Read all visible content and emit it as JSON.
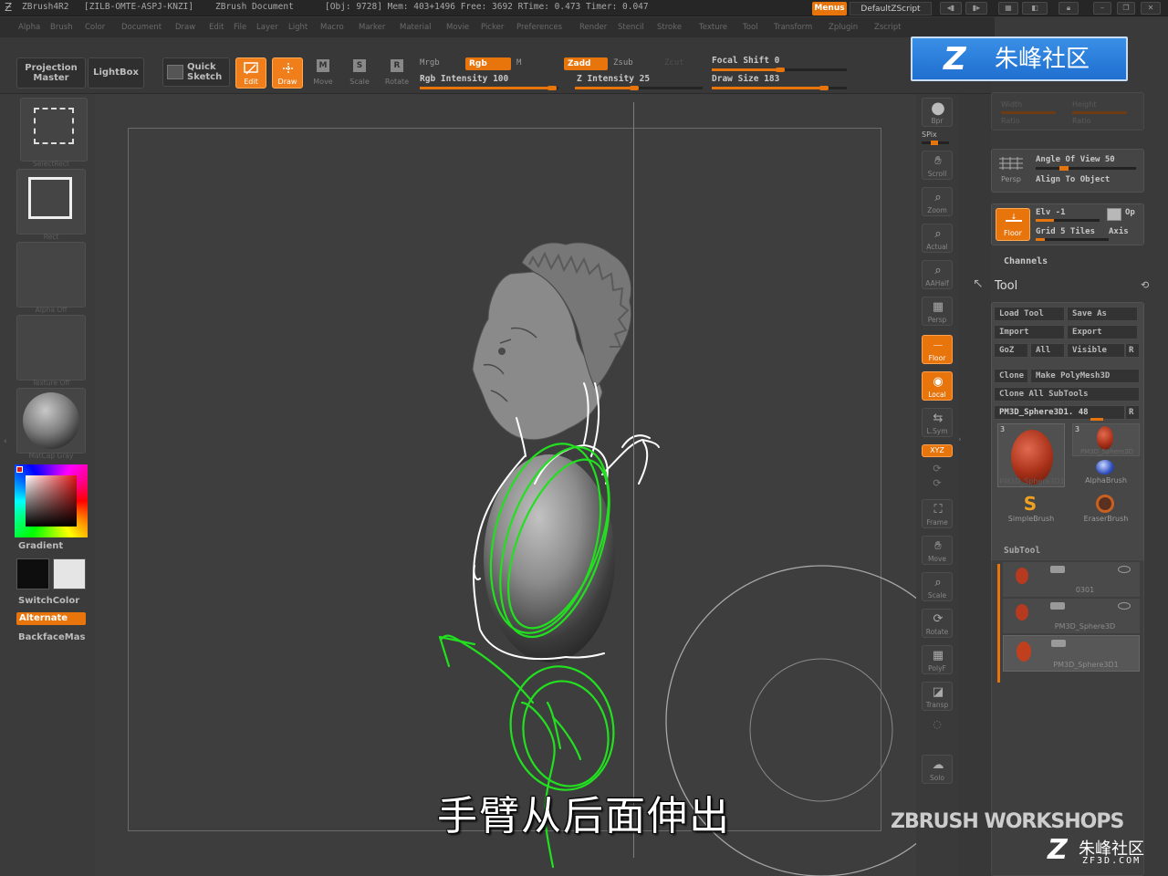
{
  "titlebar": {
    "app": "ZBrush4R2",
    "serial": "[ZILB-OMTE-ASPJ-KNZI]",
    "document": "ZBrush Document",
    "stats": "[Obj: 9728] Mem: 403+1496 Free: 3692 RTime: 0.473 Timer: 0.047",
    "menus_label": "Menus",
    "script_label": "DefaultZScript"
  },
  "menubar": [
    "Alpha",
    "Brush",
    "Color",
    "Document",
    "Draw",
    "Edit",
    "File",
    "Layer",
    "Light",
    "Macro",
    "Marker",
    "Material",
    "Movie",
    "Picker",
    "Preferences",
    "Render",
    "Stencil",
    "Stroke",
    "Texture",
    "Tool",
    "Transform",
    "Zplugin",
    "Zscript"
  ],
  "topshelf": {
    "projection_master": "Projection\nMaster",
    "lightbox": "LightBox",
    "quick_sketch": "Quick\nSketch",
    "edit": "Edit",
    "draw": "Draw",
    "move": "Move",
    "scale": "Scale",
    "rotate": "Rotate",
    "mrgb": "Mrgb",
    "rgb": "Rgb",
    "m": "M",
    "rgb_intensity": "Rgb Intensity 100",
    "zadd": "Zadd",
    "zsub": "Zsub",
    "zcut": "Zcut",
    "z_intensity": "Z Intensity 25",
    "focal_shift": "Focal Shift 0",
    "draw_size": "Draw Size 183"
  },
  "leftshelf": {
    "thumb_labels": [
      "SelectRect",
      "Rect",
      "Alpha Off",
      "Texture Off",
      "MatCap Gray"
    ],
    "gradient": "Gradient",
    "switchcolor": "SwitchColor",
    "alternate": "Alternate",
    "backface": "BackfaceMas"
  },
  "rightshelf": [
    {
      "label": "Bpr",
      "icon": "sphere-icon"
    },
    {
      "label": "SPix",
      "icon": "spix-slider"
    },
    {
      "label": "Scroll",
      "icon": "hand-icon"
    },
    {
      "label": "Zoom",
      "icon": "magnifier-icon"
    },
    {
      "label": "Actual",
      "icon": "magnifier-icon"
    },
    {
      "label": "AAHalf",
      "icon": "magnifier-icon"
    },
    {
      "label": "Persp",
      "icon": "grid-icon"
    },
    {
      "label": "Floor",
      "icon": "floor-icon"
    },
    {
      "label": "Local",
      "icon": "local-icon"
    },
    {
      "label": "L.Sym",
      "icon": "arrows-icon"
    },
    {
      "label": "XYZ",
      "icon": "xyz-icon"
    },
    {
      "label": "Frame",
      "icon": "frame-icon"
    },
    {
      "label": "Move",
      "icon": "hand-icon"
    },
    {
      "label": "Scale",
      "icon": "magnifier-icon"
    },
    {
      "label": "Rotate",
      "icon": "rotate-icon"
    },
    {
      "label": "PolyF",
      "icon": "grid-icon"
    },
    {
      "label": "Transp",
      "icon": "transp-icon"
    },
    {
      "label": "Solo",
      "icon": "solo-icon"
    }
  ],
  "brand": {
    "banner_z": "Z",
    "banner_text": "朱峰社区",
    "corner_z": "Z",
    "corner_cn": "朱峰社区",
    "corner_url": "ZF3D.COM",
    "workshops": "ZBRUSH WORKSHOPS"
  },
  "rightpanel": {
    "width_label": "Width",
    "height_label": "Height",
    "ratio_label": "Ratio",
    "persp_label": "Persp",
    "angle_of_view": "Angle Of View 50",
    "align_to_object": "Align To Object",
    "floor_label": "Floor",
    "elv": "Elv -1",
    "op": "Op",
    "grid_tiles": "Grid 5 Tiles",
    "axis": "Axis",
    "channels": "Channels",
    "tool_title": "Tool",
    "load_tool": "Load Tool",
    "save_as": "Save As",
    "import": "Import",
    "export": "Export",
    "goz": "GoZ",
    "all": "All",
    "visible": "Visible",
    "r": "R",
    "clone": "Clone",
    "make_polymesh": "Make PolyMesh3D",
    "clone_all": "Clone All SubTools",
    "current_tool": "PM3D_Sphere3D1. 48",
    "tool_count_a": "3",
    "tool_count_b": "3",
    "tool_thumbs": [
      "PM3D_Sphere3D1",
      "PM3D_Sphere3D",
      "AlphaBrush",
      "SimpleBrush",
      "EraserBrush"
    ],
    "subtool_title": "SubTool",
    "subtools": [
      "0301",
      "PM3D_Sphere3D",
      "PM3D_Sphere3D1"
    ]
  },
  "canvas": {
    "subtitle": "手臂从后面伸出"
  },
  "colors": {
    "accent": "#e8740c",
    "sketch_green": "#22e01f",
    "sketch_white": "#ffffff",
    "banner_blue": "#2a7fdc"
  }
}
